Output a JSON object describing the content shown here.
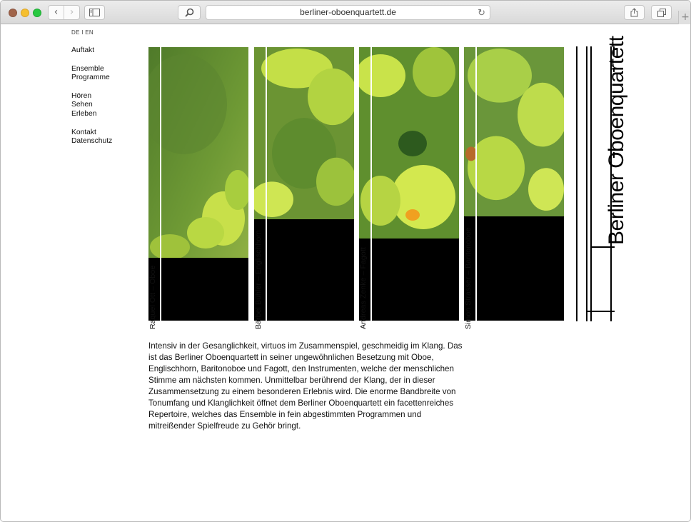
{
  "browser": {
    "url": "berliner-oboenquartett.de",
    "back_icon": "‹",
    "forward_icon": "›",
    "new_tab_icon": "+"
  },
  "page": {
    "lang_switch": "DE I EN",
    "nav": {
      "group1": [
        "Auftakt"
      ],
      "group2": [
        "Ensemble",
        "Programme"
      ],
      "group3": [
        "Hören",
        "Sehen",
        "Erleben"
      ],
      "group4": [
        "Kontakt",
        "Datenschutz"
      ]
    },
    "members": [
      "Raquel Ott – Oboe",
      "Bärbel Bühler – Englischhorn",
      "Andreas Zenke – Fagott",
      "Simon Strasser – Baritonoboe"
    ],
    "member_photo_fraction": [
      0.77,
      0.63,
      0.7,
      0.62
    ],
    "logo_text": "Berliner Oboenquartett",
    "intro": "Intensiv in der Gesanglichkeit, virtuos im Zusammenspiel, geschmeidig im Klang. Das ist das Berliner Oboenquartett in seiner ungewöhnlichen Besetzung mit Oboe, Englischhorn, Baritonoboe und Fagott, den Instrumenten, welche der menschlichen Stimme am nächsten kommen. Unmittelbar berührend der Klang, der in dieser Zusammensetzung zu einem besonderen Erlebnis wird. Die enorme Bandbreite von Tonumfang und Klanglichkeit öffnet dem Berliner Oboenquartett ein facettenreiches Repertoire, welches das Ensemble in fein abgestimmten Programmen und mitreißender Spielfreude zu Gehör bringt."
  },
  "colors": {
    "leaf_light": "#c9e34a",
    "leaf_dark": "#5f8a2a",
    "accent": "#000000"
  }
}
